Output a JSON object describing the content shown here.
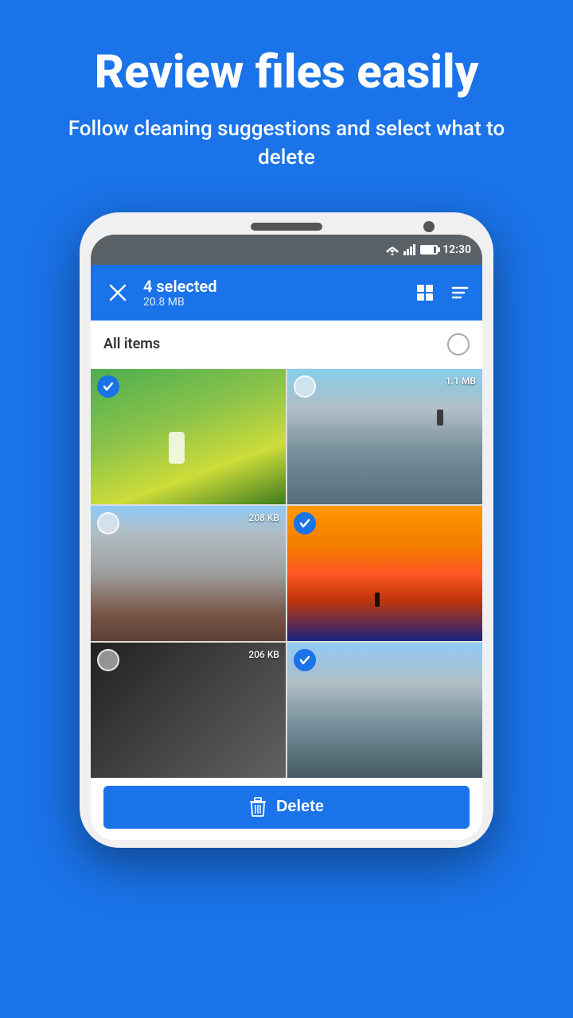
{
  "hero": {
    "title": "Review files easily",
    "subtitle": "Follow cleaning suggestions and select what to delete"
  },
  "status_bar": {
    "time": "12:30"
  },
  "app_bar": {
    "selected_count": "4 selected",
    "selected_size": "20.8 MB",
    "close_label": "Close",
    "grid_label": "Grid view",
    "sort_label": "Sort"
  },
  "all_items": {
    "label": "All items"
  },
  "photos": [
    {
      "id": 1,
      "checked": true,
      "size": null,
      "type": "green"
    },
    {
      "id": 2,
      "checked": false,
      "size": "1.1 MB",
      "type": "cliff"
    },
    {
      "id": 3,
      "checked": false,
      "size": "208 KB",
      "type": "mountain"
    },
    {
      "id": 4,
      "checked": true,
      "size": null,
      "type": "sunset"
    },
    {
      "id": 5,
      "checked": false,
      "size": "206 KB",
      "type": "dark"
    },
    {
      "id": 6,
      "checked": true,
      "size": null,
      "type": "city"
    }
  ],
  "delete_button": {
    "label": "Delete"
  }
}
